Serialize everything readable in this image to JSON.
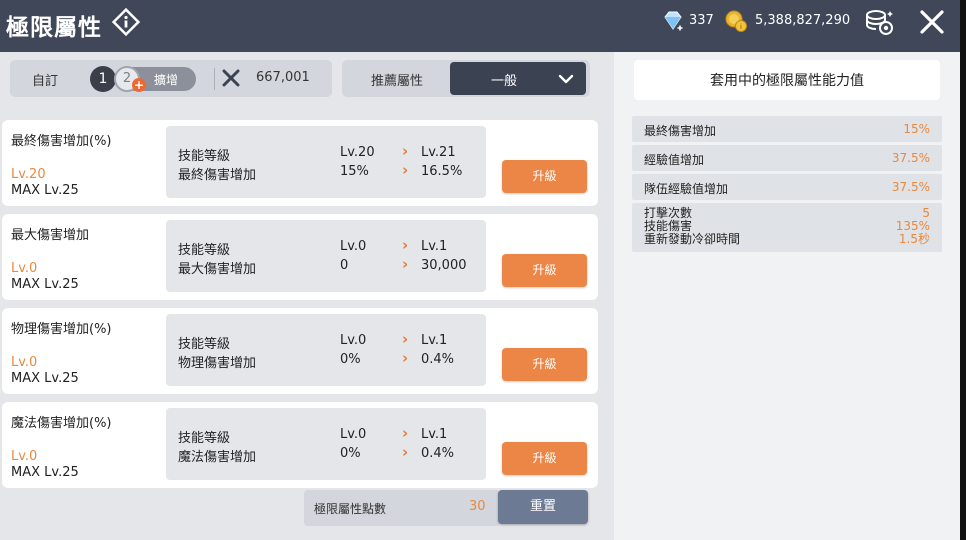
{
  "header": {
    "title": "極限屬性",
    "gem_count": "337",
    "gold_count": "5,388,827,290"
  },
  "preset": {
    "label": "自訂",
    "slot1": "1",
    "slot2": "2",
    "expand_label": "擴增",
    "power_value": "667,001"
  },
  "recommend": {
    "label": "推薦屬性",
    "selected": "一般"
  },
  "attributes": [
    {
      "name": "最終傷害增加(%)",
      "level": "Lv.20",
      "max": "MAX Lv.25",
      "row1_label": "技能等級",
      "row1_cur": "Lv.20",
      "row1_next": "Lv.21",
      "row2_label": "最終傷害增加",
      "row2_cur": "15%",
      "row2_next": "16.5%",
      "button": "升級"
    },
    {
      "name": "最大傷害增加",
      "level": "Lv.0",
      "max": "MAX Lv.25",
      "row1_label": "技能等級",
      "row1_cur": "Lv.0",
      "row1_next": "Lv.1",
      "row2_label": "最大傷害增加",
      "row2_cur": "0",
      "row2_next": "30,000",
      "button": "升級"
    },
    {
      "name": "物理傷害增加(%)",
      "level": "Lv.0",
      "max": "MAX Lv.25",
      "row1_label": "技能等級",
      "row1_cur": "Lv.0",
      "row1_next": "Lv.1",
      "row2_label": "物理傷害增加",
      "row2_cur": "0%",
      "row2_next": "0.4%",
      "button": "升級"
    },
    {
      "name": "魔法傷害增加(%)",
      "level": "Lv.0",
      "max": "MAX Lv.25",
      "row1_label": "技能等級",
      "row1_cur": "Lv.0",
      "row1_next": "Lv.1",
      "row2_label": "魔法傷害增加",
      "row2_cur": "0%",
      "row2_next": "0.4%",
      "button": "升級"
    }
  ],
  "points": {
    "label": "極限屬性點數",
    "value": "30",
    "reset_label": "重置"
  },
  "applied": {
    "title": "套用中的極限屬性能力值",
    "rows": [
      {
        "label": "最終傷害增加",
        "value": "15%"
      },
      {
        "label": "經驗值增加",
        "value": "37.5%"
      },
      {
        "label": "隊伍經驗值增加",
        "value": "37.5%"
      }
    ],
    "multi": [
      {
        "label": "打擊次數",
        "value": "5"
      },
      {
        "label": "技能傷害",
        "value": "135%"
      },
      {
        "label": "重新發動冷卻時間",
        "value": "1.5秒"
      }
    ]
  },
  "colors": {
    "accent_orange": "#ec8647",
    "header_bg": "#3f4758",
    "reset_button": "#6c7a93"
  }
}
